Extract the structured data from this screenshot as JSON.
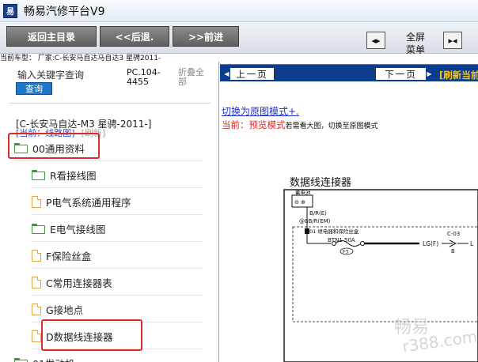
{
  "window": {
    "title": "畅易汽修平台V9",
    "app_icon_text": "易"
  },
  "toolbar": {
    "home": "返回主目录",
    "back": "<<后退.",
    "forward": ">>前进",
    "fullscreen_line1": "全屏",
    "fullscreen_line2": "菜单",
    "sq1_glyph": "◂▸",
    "sq2_glyph": "▸◂"
  },
  "vehicle_line": "当前车型： 厂家:C-长安马自达马自达3 星骋2011-",
  "left": {
    "search_hint": "输入关键字查询",
    "search_button": "查询",
    "pc_code": "PC.104-4455",
    "collapse_all": "折叠全部",
    "model": "[C-长安马自达-M3 星骋-2011-]",
    "current_label": "[当前：线路图]",
    "refresh": "[刷新]",
    "tree": [
      {
        "label": "00通用资料",
        "icon": "folder-icon"
      },
      {
        "label": "R看接线图",
        "icon": "folder-icon"
      },
      {
        "label": "P电气系统通用程序",
        "icon": "file-icon"
      },
      {
        "label": "E电气接线图",
        "icon": "folder-icon"
      },
      {
        "label": "F保险丝盒",
        "icon": "file-icon"
      },
      {
        "label": "C常用连接器表",
        "icon": "file-icon"
      },
      {
        "label": "G接地点",
        "icon": "file-icon"
      },
      {
        "label": "D数据线连接器",
        "icon": "file-icon"
      },
      {
        "label": "01发动机",
        "icon": "folder-icon"
      }
    ]
  },
  "right": {
    "prev_page": "上一页",
    "next_page": "下一页",
    "refresh_current": "[刷新当前",
    "switch_link": "切换为原图模式+.",
    "preview_red": "当前：预览模式",
    "preview_note": "若需看大图，切换至原图模式",
    "diagram_title": "数据线连接器",
    "diagram": {
      "battery": "蓄电池",
      "wire1": "B/R(E)",
      "wire2": "@8B/R(EM)",
      "relay_box": "F-01 继电器和保险丝盒",
      "fuse": "BTN1 50A",
      "fuse_id": "F3",
      "wire3": "LG(F)",
      "conn": "C-03",
      "pin": "B",
      "wire4": "L"
    }
  },
  "watermark": {
    "line1": "畅易",
    "line2": "r388.com"
  }
}
